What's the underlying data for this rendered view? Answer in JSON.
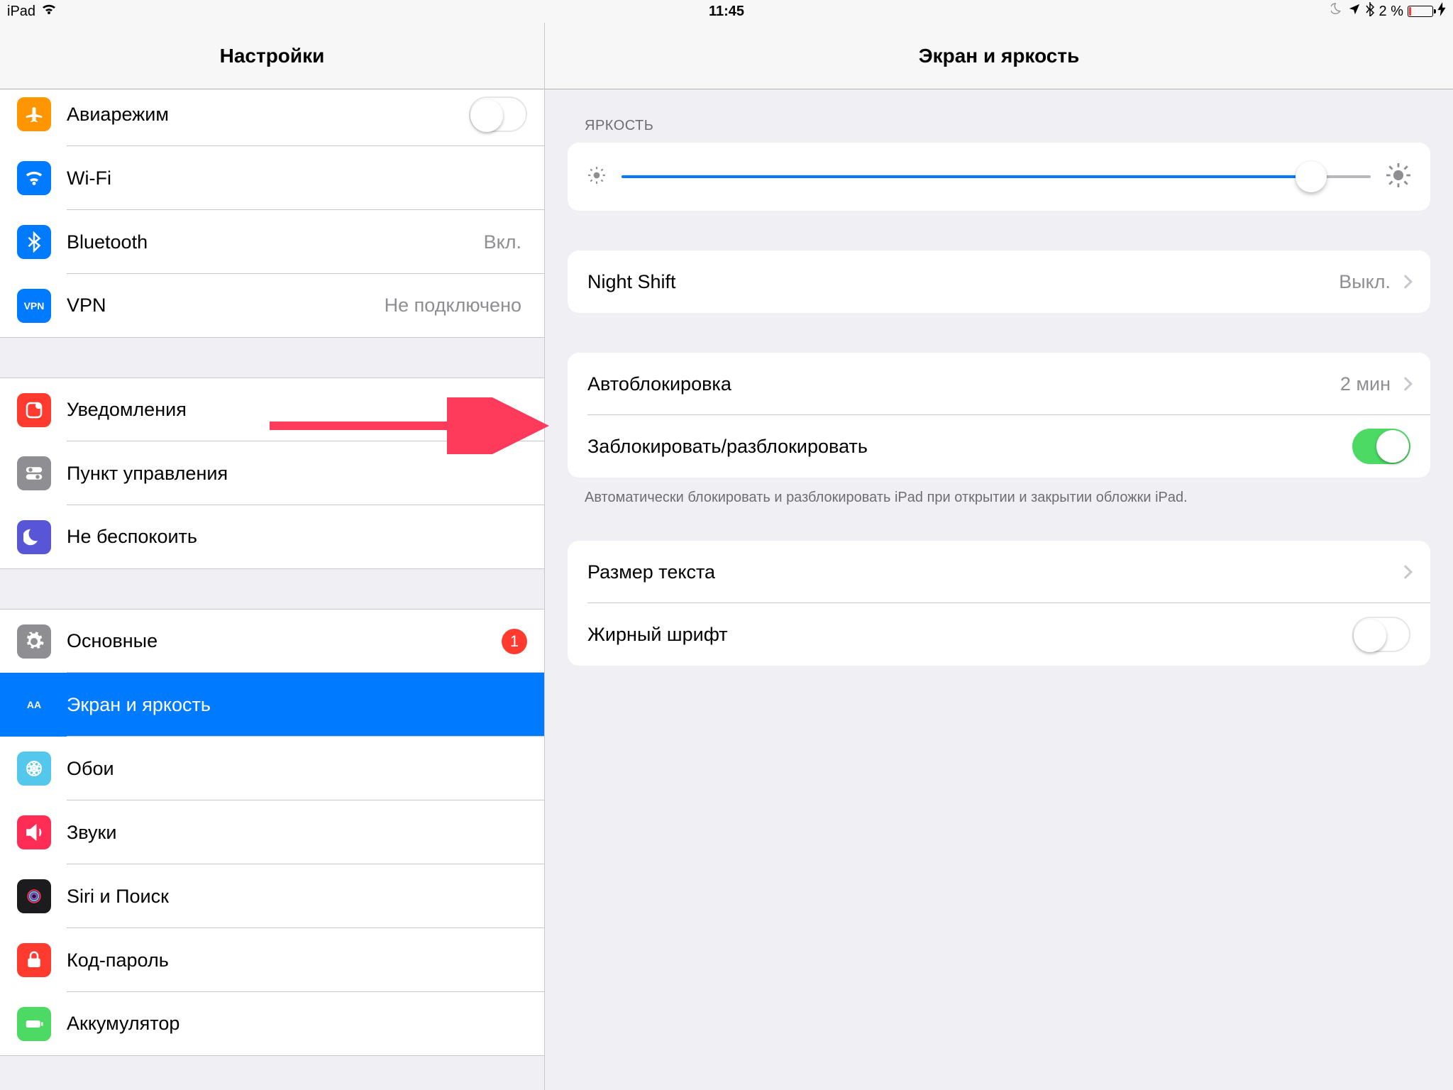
{
  "status": {
    "device": "iPad",
    "time": "11:45",
    "battery_pct": "2 %"
  },
  "sidebar": {
    "title": "Настройки",
    "group1": [
      {
        "id": "airplane",
        "label": "Авиарежим",
        "bg": "#ff9500"
      },
      {
        "id": "wifi",
        "label": "Wi-Fi",
        "bg": "#007aff"
      },
      {
        "id": "bluetooth",
        "label": "Bluetooth",
        "bg": "#007aff",
        "value": "Вкл."
      },
      {
        "id": "vpn",
        "label": "VPN",
        "bg": "#007aff",
        "value": "Не подключено",
        "icon_text": "VPN"
      }
    ],
    "group2": [
      {
        "id": "notifications",
        "label": "Уведомления",
        "bg": "#ff3b30"
      },
      {
        "id": "controlcenter",
        "label": "Пункт управления",
        "bg": "#8e8e93"
      },
      {
        "id": "dnd",
        "label": "Не беспокоить",
        "bg": "#5856d6"
      }
    ],
    "group3": [
      {
        "id": "general",
        "label": "Основные",
        "bg": "#8e8e93",
        "badge": "1"
      },
      {
        "id": "display",
        "label": "Экран и яркость",
        "bg": "#007aff",
        "selected": true,
        "icon_text": "AA"
      },
      {
        "id": "wallpaper",
        "label": "Обои",
        "bg": "#54c7ec"
      },
      {
        "id": "sounds",
        "label": "Звуки",
        "bg": "#ff2d55"
      },
      {
        "id": "siri",
        "label": "Siri и Поиск",
        "bg": "#1c1c1e"
      },
      {
        "id": "passcode",
        "label": "Код-пароль",
        "bg": "#ff3b30"
      },
      {
        "id": "battery",
        "label": "Аккумулятор",
        "bg": "#4cd964"
      }
    ]
  },
  "detail": {
    "title": "Экран и яркость",
    "brightness_header": "Яркость",
    "nightshift": {
      "label": "Night Shift",
      "value": "Выкл."
    },
    "autolock": {
      "label": "Автоблокировка",
      "value": "2 мин"
    },
    "lockunlock": {
      "label": "Заблокировать/разблокировать",
      "on": true
    },
    "lockunlock_note": "Автоматически блокировать и разблокировать iPad при открытии и закрытии обложки iPad.",
    "textsize": {
      "label": "Размер текста"
    },
    "boldtext": {
      "label": "Жирный шрифт",
      "on": false
    }
  }
}
